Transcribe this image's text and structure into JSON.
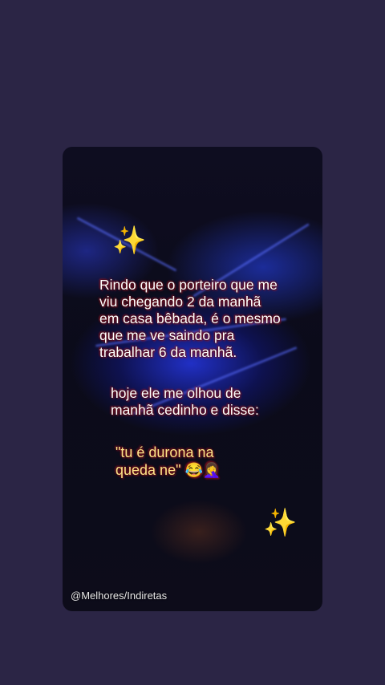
{
  "post": {
    "paragraph1": "Rindo que o porteiro que me viu chegando 2 da manhã em casa bêbada, é o mesmo que me ve saindo pra trabalhar 6 da manhã.",
    "paragraph2": "hoje ele me olhou de manhã cedinho e disse:",
    "quote": "\"tu é durona na queda ne\" 😂🤦‍♀️",
    "watermark": "@Melhores/Indiretas"
  },
  "icons": {
    "top_sparkle": "sparkles-icon",
    "bottom_sparkle": "sparkles-icon"
  },
  "colors": {
    "background": "#2b2545",
    "text_white": "#ffffff",
    "text_yellow": "#ffe58a",
    "text_outline": "#c0192a"
  }
}
